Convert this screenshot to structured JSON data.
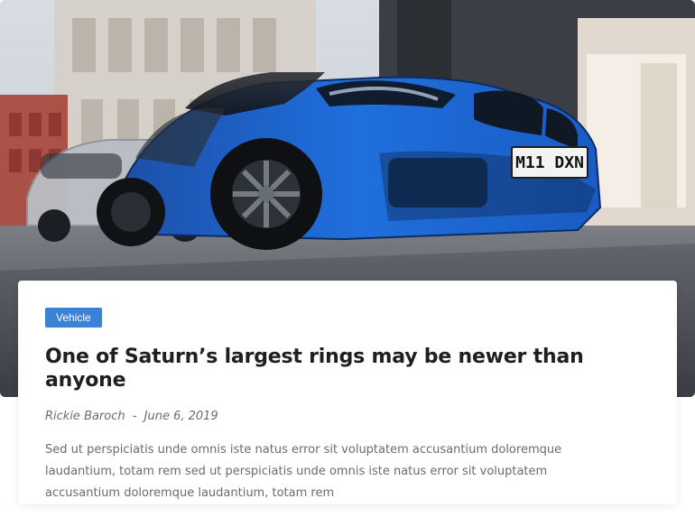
{
  "hero": {
    "image_icon": "photo-image"
  },
  "post": {
    "category": "Vehicle",
    "title": "One of Saturn’s largest rings may be newer than anyone",
    "author": "Rickie Baroch",
    "date_separator": "-",
    "date": "June 6, 2019",
    "excerpt": "Sed ut perspiciatis unde omnis iste natus error sit voluptatem accusantium doloremque laudantium, totam rem sed ut perspiciatis unde omnis iste natus error sit voluptatem accusantium doloremque laudantium, totam rem"
  },
  "colors": {
    "category_badge": "#3b82d6",
    "title": "#1f1f1f",
    "meta": "#6c6c6c",
    "excerpt": "#6b6b6b",
    "background": "#ffffff"
  },
  "hero_image_text": {
    "license_plate": "M11 DXN"
  }
}
